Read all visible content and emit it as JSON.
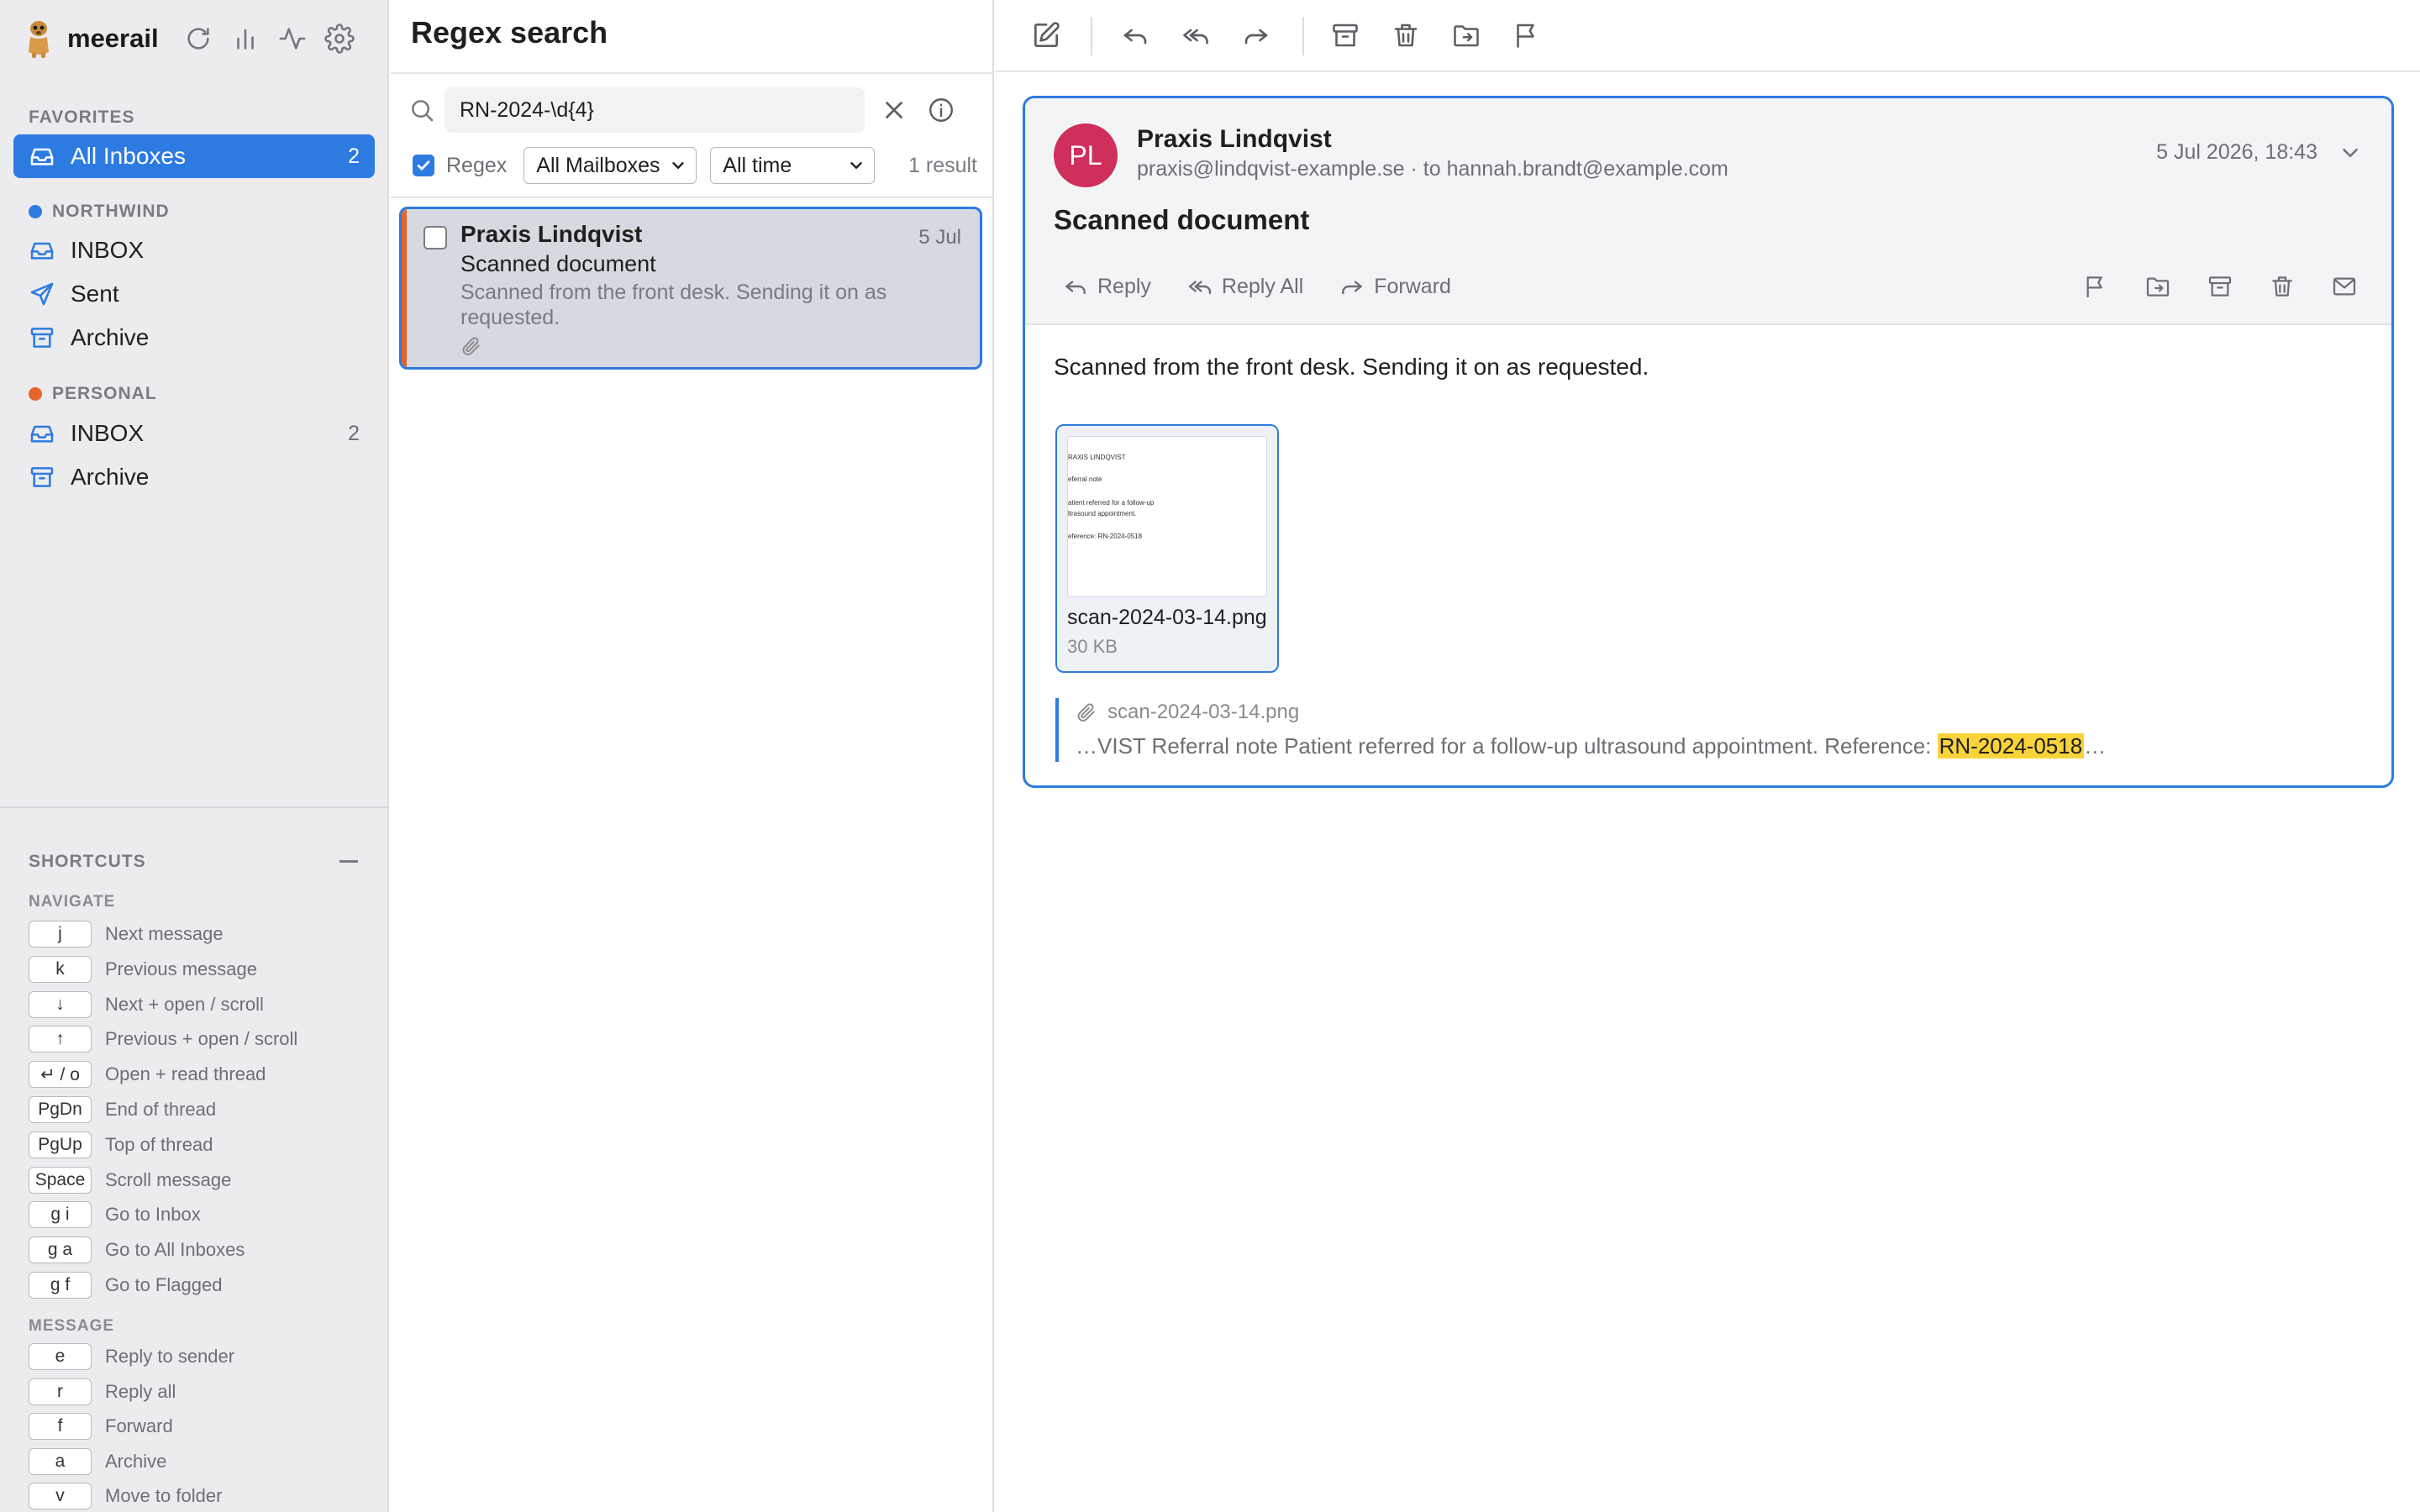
{
  "app": {
    "name": "meerail"
  },
  "sidebar": {
    "favorites_label": "FAVORITES",
    "all_inboxes": {
      "label": "All Inboxes",
      "count": "2"
    },
    "accounts": [
      {
        "name": "NORTHWIND",
        "color": "#2d7be0",
        "folders": [
          {
            "label": "INBOX",
            "count": ""
          },
          {
            "label": "Sent",
            "count": ""
          },
          {
            "label": "Archive",
            "count": ""
          }
        ]
      },
      {
        "name": "PERSONAL",
        "color": "#e6642b",
        "folders": [
          {
            "label": "INBOX",
            "count": "2"
          },
          {
            "label": "Archive",
            "count": ""
          }
        ]
      }
    ],
    "shortcuts": {
      "title": "SHORTCUTS",
      "navigate_label": "NAVIGATE",
      "navigate": [
        {
          "key": "j",
          "desc": "Next message"
        },
        {
          "key": "k",
          "desc": "Previous message"
        },
        {
          "key": "↓",
          "desc": "Next + open / scroll"
        },
        {
          "key": "↑",
          "desc": "Previous + open / scroll"
        },
        {
          "key": "↵ / o",
          "desc": "Open + read thread"
        },
        {
          "key": "PgDn",
          "desc": "End of thread"
        },
        {
          "key": "PgUp",
          "desc": "Top of thread"
        },
        {
          "key": "Space",
          "desc": "Scroll message"
        },
        {
          "key": "g i",
          "desc": "Go to Inbox"
        },
        {
          "key": "g a",
          "desc": "Go to All Inboxes"
        },
        {
          "key": "g f",
          "desc": "Go to Flagged"
        }
      ],
      "message_label": "MESSAGE",
      "message": [
        {
          "key": "e",
          "desc": "Reply to sender"
        },
        {
          "key": "r",
          "desc": "Reply all"
        },
        {
          "key": "f",
          "desc": "Forward"
        },
        {
          "key": "a",
          "desc": "Archive"
        },
        {
          "key": "v",
          "desc": "Move to folder"
        }
      ]
    }
  },
  "search": {
    "title": "Regex search",
    "query": "RN-2024-\\d{4}",
    "regex_label": "Regex",
    "regex_checked": true,
    "mailbox_filter": "All Mailboxes",
    "time_filter": "All time",
    "result_count": "1 result"
  },
  "results": [
    {
      "from": "Praxis Lindqvist",
      "date": "5 Jul",
      "subject": "Scanned document",
      "preview": "Scanned from the front desk. Sending it on as requested.",
      "has_attachment": true
    }
  ],
  "message": {
    "avatar_initials": "PL",
    "avatar_color": "#cf2f5b",
    "from_name": "Praxis Lindqvist",
    "from_email": "praxis@lindqvist-example.se",
    "to_line": "· to hannah.brandt@example.com",
    "date": "5 Jul 2026, 18:43",
    "subject": "Scanned document",
    "actions": {
      "reply": "Reply",
      "reply_all": "Reply All",
      "forward": "Forward"
    },
    "body": "Scanned from the front desk. Sending it on as requested.",
    "attachment": {
      "filename": "scan-2024-03-14.png",
      "size": "30 KB",
      "thumbnail_lines": [
        "RAXIS LINDQVIST",
        "eferral note",
        "atient referred for a follow-up",
        "ltrasound appointment.",
        "eference: RN-2024-0518"
      ]
    },
    "snippet": {
      "filename": "scan-2024-03-14.png",
      "prefix": "…VIST Referral note Patient referred for a follow-up ultrasound appointment. Reference: ",
      "match": "RN-2024-0518",
      "suffix": "…"
    }
  },
  "colors": {
    "accent": "#2d7be0",
    "unread_marker": "#e6642b",
    "highlight": "#f9d33a"
  }
}
